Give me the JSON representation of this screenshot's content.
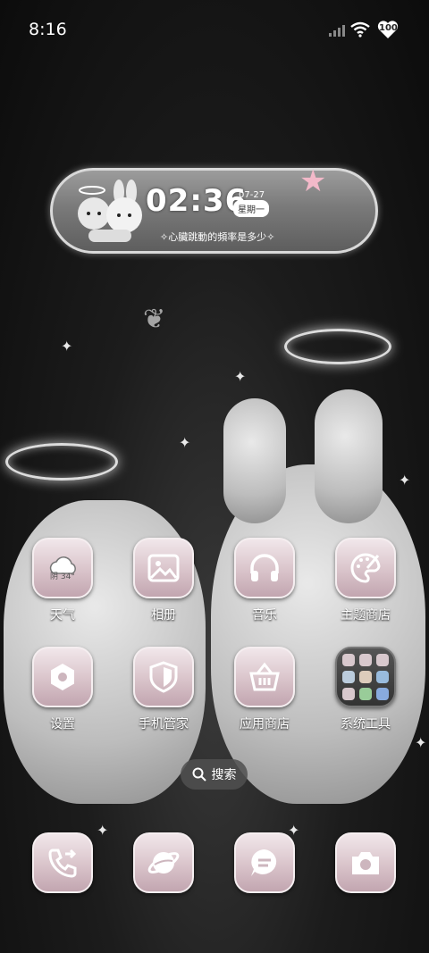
{
  "status_bar": {
    "time": "8:16",
    "battery": "100"
  },
  "widget": {
    "time": "02:36",
    "date": "07-27",
    "weekday": "星期一",
    "caption": "✧心臟跳動的頻率是多少✧"
  },
  "apps": [
    {
      "label": "天气",
      "icon": "weather-icon",
      "temp": "阴 34°"
    },
    {
      "label": "相册",
      "icon": "gallery-icon"
    },
    {
      "label": "音乐",
      "icon": "headphones-icon"
    },
    {
      "label": "主题商店",
      "icon": "palette-icon"
    },
    {
      "label": "设置",
      "icon": "settings-icon"
    },
    {
      "label": "手机管家",
      "icon": "shield-icon"
    },
    {
      "label": "应用商店",
      "icon": "basket-icon"
    },
    {
      "label": "系统工具",
      "icon": "folder-icon"
    }
  ],
  "search": {
    "label": "搜索"
  },
  "dock": [
    {
      "icon": "phone-icon"
    },
    {
      "icon": "browser-icon"
    },
    {
      "icon": "messages-icon"
    },
    {
      "icon": "camera-icon"
    }
  ],
  "colors": {
    "tile_top": "#f1e7ea",
    "tile_bottom": "#c2a6b0",
    "accent_star": "#f3b9c9"
  }
}
